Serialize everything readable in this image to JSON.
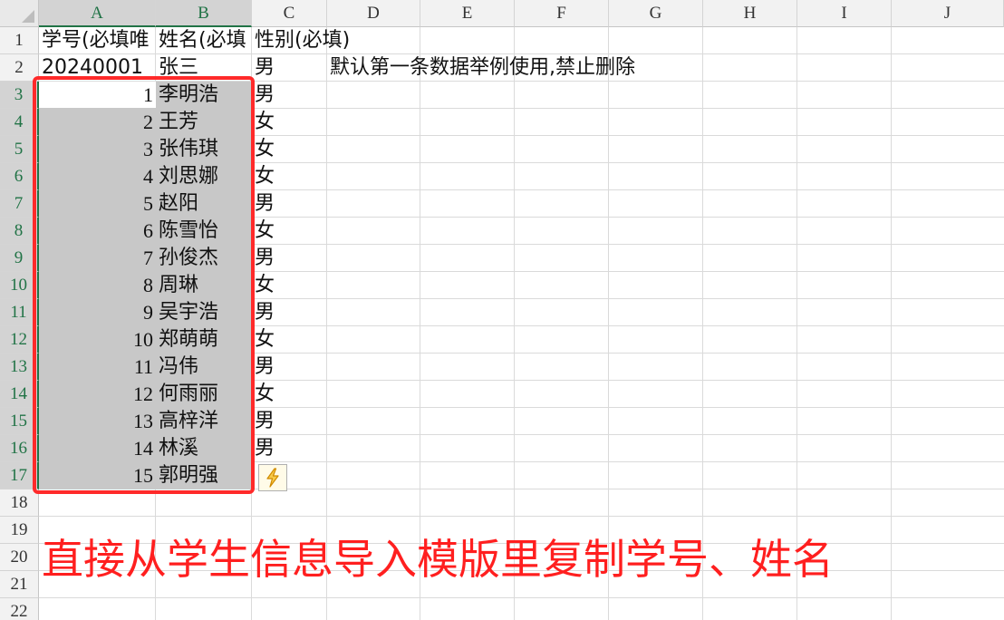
{
  "columns": [
    "A",
    "B",
    "C",
    "D",
    "E",
    "F",
    "G",
    "H",
    "I",
    "J"
  ],
  "rows": [
    "1",
    "2",
    "3",
    "4",
    "5",
    "6",
    "7",
    "8",
    "9",
    "10",
    "11",
    "12",
    "13",
    "14",
    "15",
    "16",
    "17",
    "18",
    "19",
    "20",
    "21",
    "22"
  ],
  "header_row": {
    "a": "学号(必填唯",
    "b": "姓名(必填",
    "c": "性别(必填)"
  },
  "example_row": {
    "a": "20240001",
    "b": "张三",
    "c": "男",
    "d": "默认第一条数据举例使用,禁止删除"
  },
  "students": [
    {
      "id": "1",
      "name": "李明浩",
      "gender": "男"
    },
    {
      "id": "2",
      "name": "王芳",
      "gender": "女"
    },
    {
      "id": "3",
      "name": "张伟琪",
      "gender": "女"
    },
    {
      "id": "4",
      "name": "刘思娜",
      "gender": "女"
    },
    {
      "id": "5",
      "name": "赵阳",
      "gender": "男"
    },
    {
      "id": "6",
      "name": "陈雪怡",
      "gender": "女"
    },
    {
      "id": "7",
      "name": "孙俊杰",
      "gender": "男"
    },
    {
      "id": "8",
      "name": "周琳",
      "gender": "女"
    },
    {
      "id": "9",
      "name": "吴宇浩",
      "gender": "男"
    },
    {
      "id": "10",
      "name": "郑萌萌",
      "gender": "女"
    },
    {
      "id": "11",
      "name": "冯伟",
      "gender": "男"
    },
    {
      "id": "12",
      "name": "何雨丽",
      "gender": "女"
    },
    {
      "id": "13",
      "name": "高梓洋",
      "gender": "男"
    },
    {
      "id": "14",
      "name": "林溪",
      "gender": "男"
    },
    {
      "id": "15",
      "name": "郭明强",
      "gender": ""
    }
  ],
  "caption": "直接从学生信息导入模版里复制学号、姓名",
  "colors": {
    "annotation": "#ff1f1f",
    "selection_header": "#217346",
    "selection_fill": "#c8c8c8"
  },
  "icons": {
    "quick_analysis": "lightning-icon"
  }
}
